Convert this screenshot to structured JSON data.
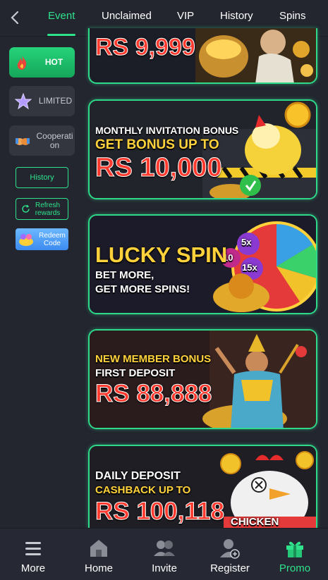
{
  "tabs": [
    {
      "label": "Event",
      "active": true
    },
    {
      "label": "Unclaimed",
      "active": false
    },
    {
      "label": "VIP",
      "active": false
    },
    {
      "label": "History",
      "active": false
    },
    {
      "label": "Spins",
      "active": false
    }
  ],
  "sidebar": {
    "hot": {
      "label": "HOT",
      "icon": "flame-icon"
    },
    "limited": {
      "label": "LIMITED",
      "icon": "star-icon"
    },
    "cooperation": {
      "label": "Cooperati on",
      "icon": "handshake-icon"
    },
    "history_label": "History",
    "refresh_label": "Refresh rewards",
    "redeem_label": "Redeem Code"
  },
  "banners": [
    {
      "line1": "",
      "line2": "",
      "amount": "RS 9,999"
    },
    {
      "line1": "MONTHLY INVITATION BONUS",
      "line2": "GET BONUS UP TO",
      "amount": "RS 10,000"
    },
    {
      "line1": "LUCKY SPIN",
      "line2": "BET MORE,",
      "line3": "GET MORE SPINS!",
      "wheel": [
        "5x",
        "10",
        "15x"
      ]
    },
    {
      "line1": "NEW MEMBER BONUS",
      "line2": "FIRST DEPOSIT",
      "amount": "RS 88,888"
    },
    {
      "line1": "DAILY DEPOSIT",
      "line2": "CASHBACK UP TO",
      "amount": "RS 100,118",
      "tag": "CHICKEN"
    }
  ],
  "bottom_nav": [
    {
      "label": "More",
      "icon": "menu-icon"
    },
    {
      "label": "Home",
      "icon": "home-icon"
    },
    {
      "label": "Invite",
      "icon": "users-icon"
    },
    {
      "label": "Register",
      "icon": "user-add-icon"
    },
    {
      "label": "Promo",
      "icon": "gift-icon",
      "active": true
    }
  ],
  "colors": {
    "accent": "#2ee38c",
    "background": "#23252f",
    "banner_border": "#2fd98a"
  }
}
